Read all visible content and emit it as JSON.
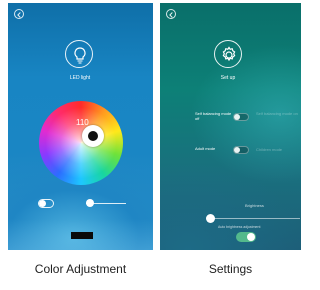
{
  "left_screen": {
    "header_label": "LED light",
    "wheel_value": "110",
    "caption": "Color Adjustment",
    "toggle_on": false,
    "slider_level": 0.0
  },
  "right_screen": {
    "header_label": "Set up",
    "self_balancing": {
      "label": "Self balancing mode off",
      "status": "Self balancing mode on"
    },
    "adult_mode": {
      "label": "Adult mode",
      "status": "Children mode"
    },
    "brightness_label": "Brightness",
    "brightness_level": 0.0,
    "auto_brightness_label": "Auto brightness adjustment",
    "auto_brightness_on": true,
    "caption": "Settings"
  },
  "colors": {
    "left_bg": "#1a86c4",
    "right_bg": "#0d8077",
    "toggle_on": "#53b98c"
  },
  "icons": [
    "back-icon",
    "lightbulb-icon",
    "gear-icon"
  ]
}
